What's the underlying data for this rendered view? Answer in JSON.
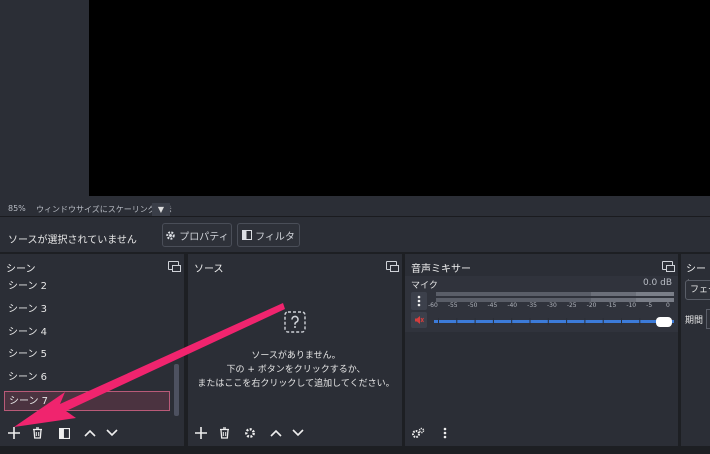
{
  "status": {
    "zoom": "85%",
    "scale_mode": "ウィンドウサイズにスケーリング表示",
    "dropdown": "▼"
  },
  "source_toolbar": {
    "message": "ソースが選択されていません",
    "properties_label": "プロパティ",
    "filters_label": "フィルタ"
  },
  "scenes": {
    "title": "シーン",
    "items": [
      "シーン 2",
      "シーン 3",
      "シーン 4",
      "シーン 5",
      "シーン 6",
      "シーン 7"
    ],
    "selected_index": 5
  },
  "sources": {
    "title": "ソース",
    "empty_line1": "ソースがありません。",
    "empty_line2": "下の + ボタンをクリックするか、",
    "empty_line3": "またはここを右クリックして追加してください。"
  },
  "mixer": {
    "title": "音声ミキサー",
    "channel_name": "マイク",
    "level": "0.0 dB",
    "scale": [
      "-60",
      "-55",
      "-50",
      "-45",
      "-40",
      "-35",
      "-30",
      "-25",
      "-20",
      "-15",
      "-10",
      "-5",
      "0"
    ],
    "volume_fraction": 1.0
  },
  "transitions": {
    "title": "シーン",
    "select_value": "フェー",
    "duration_label": "期間"
  },
  "colors": {
    "arrow": "#f0246e",
    "accent_blue": "#3c7bd9",
    "mute_red": "#d43d3d"
  }
}
